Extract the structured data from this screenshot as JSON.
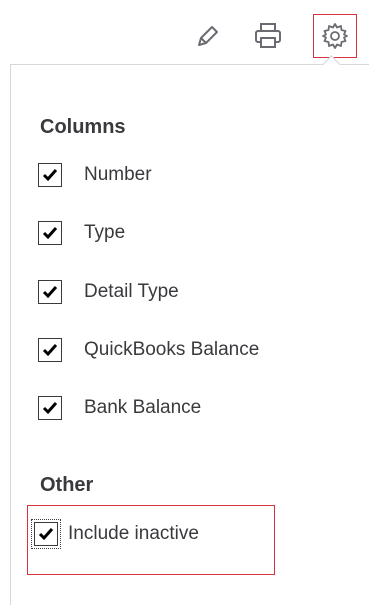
{
  "toolbar": {
    "icons": [
      "pencil-icon",
      "printer-icon",
      "gear-icon"
    ]
  },
  "columns": {
    "title": "Columns",
    "items": [
      {
        "label": "Number",
        "checked": true
      },
      {
        "label": "Type",
        "checked": true
      },
      {
        "label": "Detail Type",
        "checked": true
      },
      {
        "label": "QuickBooks Balance",
        "checked": true
      },
      {
        "label": "Bank Balance",
        "checked": true
      }
    ]
  },
  "other": {
    "title": "Other",
    "items": [
      {
        "label": "Include inactive",
        "checked": true
      }
    ]
  },
  "colors": {
    "accent": "#d6323f",
    "text": "#393a3d",
    "border": "#d4d7dc"
  }
}
